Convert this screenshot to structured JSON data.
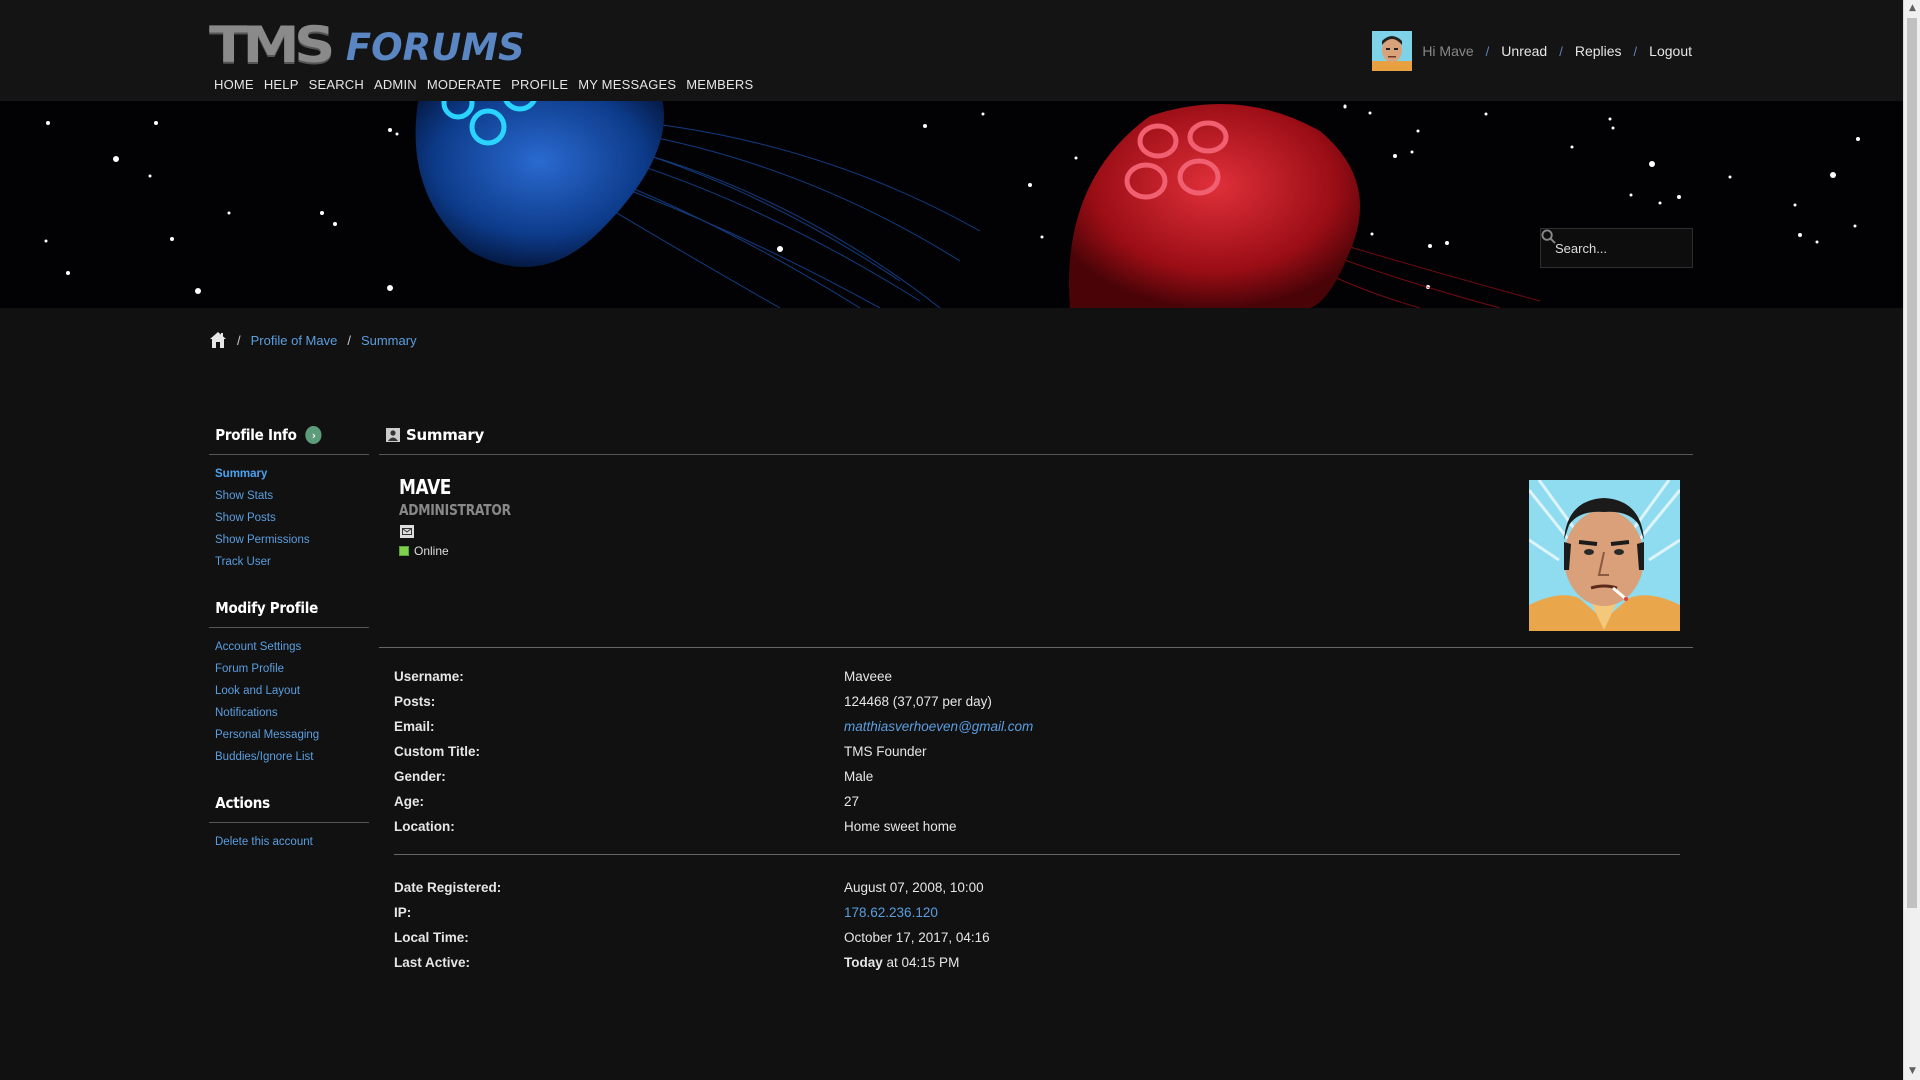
{
  "header": {
    "logo_primary": "TMS",
    "logo_secondary": "FORUMS",
    "nav": [
      "HOME",
      "HELP",
      "SEARCH",
      "ADMIN",
      "MODERATE",
      "PROFILE",
      "MY MESSAGES",
      "MEMBERS"
    ],
    "greeting": "Hi Mave",
    "links": {
      "unread": "Unread",
      "replies": "Replies",
      "logout": "Logout"
    },
    "separator": "/"
  },
  "search": {
    "placeholder": "Search..."
  },
  "breadcrumb": {
    "items": [
      "Profile of Mave",
      "Summary"
    ],
    "separator": "/"
  },
  "sidebar": {
    "profile_info": {
      "title": "Profile Info",
      "arrow": "›",
      "items": [
        "Summary",
        "Show Stats",
        "Show Posts",
        "Show Permissions",
        "Track User"
      ]
    },
    "modify_profile": {
      "title": "Modify Profile",
      "items": [
        "Account Settings",
        "Forum Profile",
        "Look and Layout",
        "Notifications",
        "Personal Messaging",
        "Buddies/Ignore List"
      ]
    },
    "actions": {
      "title": "Actions",
      "items": [
        "Delete this account"
      ]
    }
  },
  "main": {
    "title": "Summary",
    "profile": {
      "display_name": "MAVE",
      "group": "ADMINISTRATOR",
      "status": "Online"
    },
    "details": [
      {
        "label": "Username:",
        "value": "Maveee"
      },
      {
        "label": "Posts:",
        "value": "124468 (37,077 per day)"
      },
      {
        "label": "Email:",
        "value": "matthiasverhoeven@gmail.com"
      },
      {
        "label": "Custom Title:",
        "value": "TMS Founder"
      },
      {
        "label": "Gender:",
        "value": "Male"
      },
      {
        "label": "Age:",
        "value": "27"
      },
      {
        "label": "Location:",
        "value": "Home sweet home"
      }
    ],
    "details2": [
      {
        "label": "Date Registered:",
        "value": "August 07, 2008, 10:00"
      },
      {
        "label": "IP:",
        "value": "178.62.236.120"
      },
      {
        "label": "Local Time:",
        "value": "October 17, 2017, 04:16"
      },
      {
        "label": "Last Active:",
        "value_bold": "Today",
        "value_rest": " at 04:15 PM"
      }
    ]
  },
  "colors": {
    "link": "#5b9ee0",
    "online": "#7fd04b",
    "logo_blue": "#5b86c4",
    "background": "#111111"
  }
}
